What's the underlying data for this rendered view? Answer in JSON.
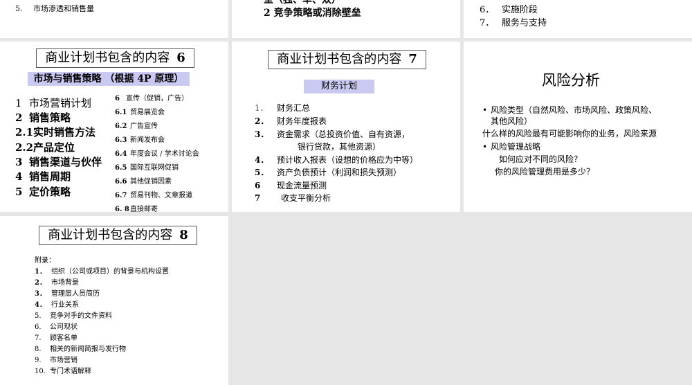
{
  "s3": {
    "item5_num": "5.",
    "item5_text": "市场渗透和销售量"
  },
  "s4": {
    "partial_top": "垒（独、单、双）",
    "line2": "2  竞争策略或消除壁垒"
  },
  "s5": {
    "items": [
      {
        "num": "6．",
        "text": "实施阶段"
      },
      {
        "num": "7．",
        "text": "服务与支持"
      }
    ]
  },
  "s6": {
    "title": "商业计划书包含的内容",
    "title_num": "6",
    "band": "市场与销售策略  （根据 4P 原理）",
    "left_items": [
      {
        "num": "1",
        "text": "市场营销计划"
      },
      {
        "num": "2",
        "text": "销售策略"
      },
      {
        "num": "2.1",
        "text": "实时销售方法"
      },
      {
        "num": "2.2",
        "text": "产品定位"
      },
      {
        "num": "3",
        "text": "销售渠道与伙伴"
      },
      {
        "num": "4",
        "text": "销售周期"
      },
      {
        "num": "5",
        "text": "定价策略"
      }
    ],
    "right_items": [
      {
        "num": "6",
        "text": "宣传（促销，广告）"
      },
      {
        "num": "6.1",
        "text": "贸易展览会"
      },
      {
        "num": "6.2",
        "text": "广告宣传"
      },
      {
        "num": "6.3",
        "text": "新闻发布会"
      },
      {
        "num": "6.4",
        "text": "年度会议 / 学术讨论会"
      },
      {
        "num": "6.5",
        "text": "国际互联网促销"
      },
      {
        "num": "6.6",
        "text": "其他促销因素"
      },
      {
        "num": "6.7",
        "text": "贸易刊物、文章报道"
      },
      {
        "num": "6. 8",
        "text": "直接邮寄"
      }
    ]
  },
  "s7": {
    "title": "商业计划书包含的内容",
    "title_num": "7",
    "band": "财务计划",
    "items": [
      {
        "num": "1．",
        "text": "财务汇总"
      },
      {
        "num": "2．",
        "text": "财务年度报表"
      },
      {
        "num": "3．",
        "text": "资金需求（总投资价值、自有资源，"
      },
      {
        "num": "",
        "text": "银行贷款，其他资源）"
      },
      {
        "num": "4．",
        "text": "预计收入报表（设想的价格应为中等）"
      },
      {
        "num": "5．",
        "text": "资产负债预计（利润和损失预测）"
      },
      {
        "num": "6",
        "text": "现金流量预测"
      },
      {
        "num": "7",
        "text": "收支平衡分析"
      }
    ]
  },
  "s8": {
    "title": "风险分析",
    "bullet1_a": "风险类型（自然风险、市场风险、政策风险、",
    "bullet1_b": "其他风险）",
    "line2": "什么样的风险最有可能影响你的业务，风险来源",
    "bullet2": "风险管理战略",
    "q1": "如何应对不同的风险？",
    "q2": "你的风险管理费用是多少？",
    "bullet_char": "•"
  },
  "s9": {
    "title": "商业计划书包含的内容",
    "title_num": "8",
    "heading": "附录：",
    "items": [
      {
        "num": "1．",
        "text": "组织（公司或项目）的背景与机构设置"
      },
      {
        "num": "2．",
        "text": "市场背景"
      },
      {
        "num": "3．",
        "text": "管理层人员简历"
      },
      {
        "num": "4．",
        "text": "行业关系"
      },
      {
        "num": "5.",
        "text": "竞争对手的文件资料"
      },
      {
        "num": "6.",
        "text": "公司现状"
      },
      {
        "num": "7.",
        "text": "顾客名单"
      },
      {
        "num": "8.",
        "text": "相关的新闻简报与发行物"
      },
      {
        "num": "9.",
        "text": "市场营销"
      },
      {
        "num": "10.",
        "text": "专门术语解释"
      }
    ]
  }
}
